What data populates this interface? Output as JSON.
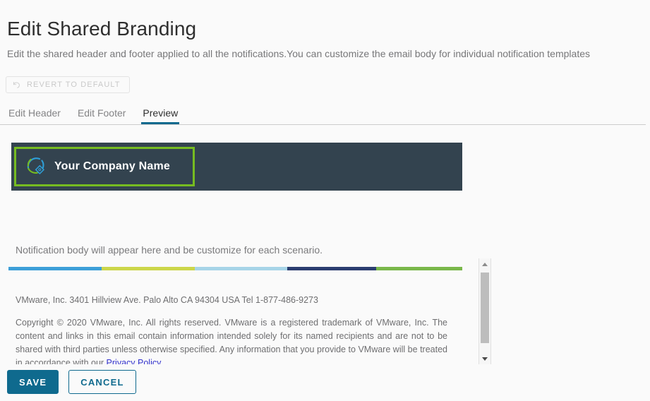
{
  "page": {
    "title": "Edit Shared Branding",
    "description": "Edit the shared header and footer applied to all the notifications.You can customize the email body for individual notification templates"
  },
  "revert_button": {
    "label": "REVERT TO DEFAULT",
    "icon": "undo-arrow-icon",
    "enabled": false
  },
  "tabs": [
    {
      "label": "Edit Header",
      "active": false
    },
    {
      "label": "Edit Footer",
      "active": false
    },
    {
      "label": "Preview",
      "active": true
    }
  ],
  "preview": {
    "banner": {
      "background_color": "#33434f",
      "selection_outline_color": "#76bc21",
      "logo_icon": "company-swoosh-logo-icon",
      "company_name": "Your Company Name"
    },
    "body_placeholder": "Notification body will appear here and be customize for each scenario.",
    "stripe": [
      {
        "color": "#3d9fd8",
        "width_pct": 20.5
      },
      {
        "color": "#ccd64a",
        "width_pct": 20.5
      },
      {
        "color": "#a7d4e8",
        "width_pct": 20.5
      },
      {
        "color": "#2b3d70",
        "width_pct": 19.5
      },
      {
        "color": "#79b74a",
        "width_pct": 19.0
      }
    ],
    "footer_address": "VMware, Inc. 3401 Hillview Ave. Palo Alto CA 94304 USA Tel 1-877-486-9273",
    "footer_copyright_before": "Copyright © 2020 VMware, Inc. All rights reserved. VMware is a registered trademark of VMware, Inc. The content and links in this email contain information intended solely for its named recipients and are not to be shared with third parties unless otherwise specified. Any information that you provide to VMware will be treated in accordance with our ",
    "footer_link_label": "Privacy Policy",
    "footer_copyright_after": "."
  },
  "scrollbar": {
    "up_arrow": "scroll-up-arrow-icon",
    "down_arrow": "scroll-down-arrow-icon"
  },
  "actions": {
    "save_label": "SAVE",
    "cancel_label": "CANCEL"
  },
  "colors": {
    "accent": "#0f6a8e",
    "brand_highlight": "#76bc21",
    "banner_bg": "#33434f",
    "link": "#3333cc"
  }
}
